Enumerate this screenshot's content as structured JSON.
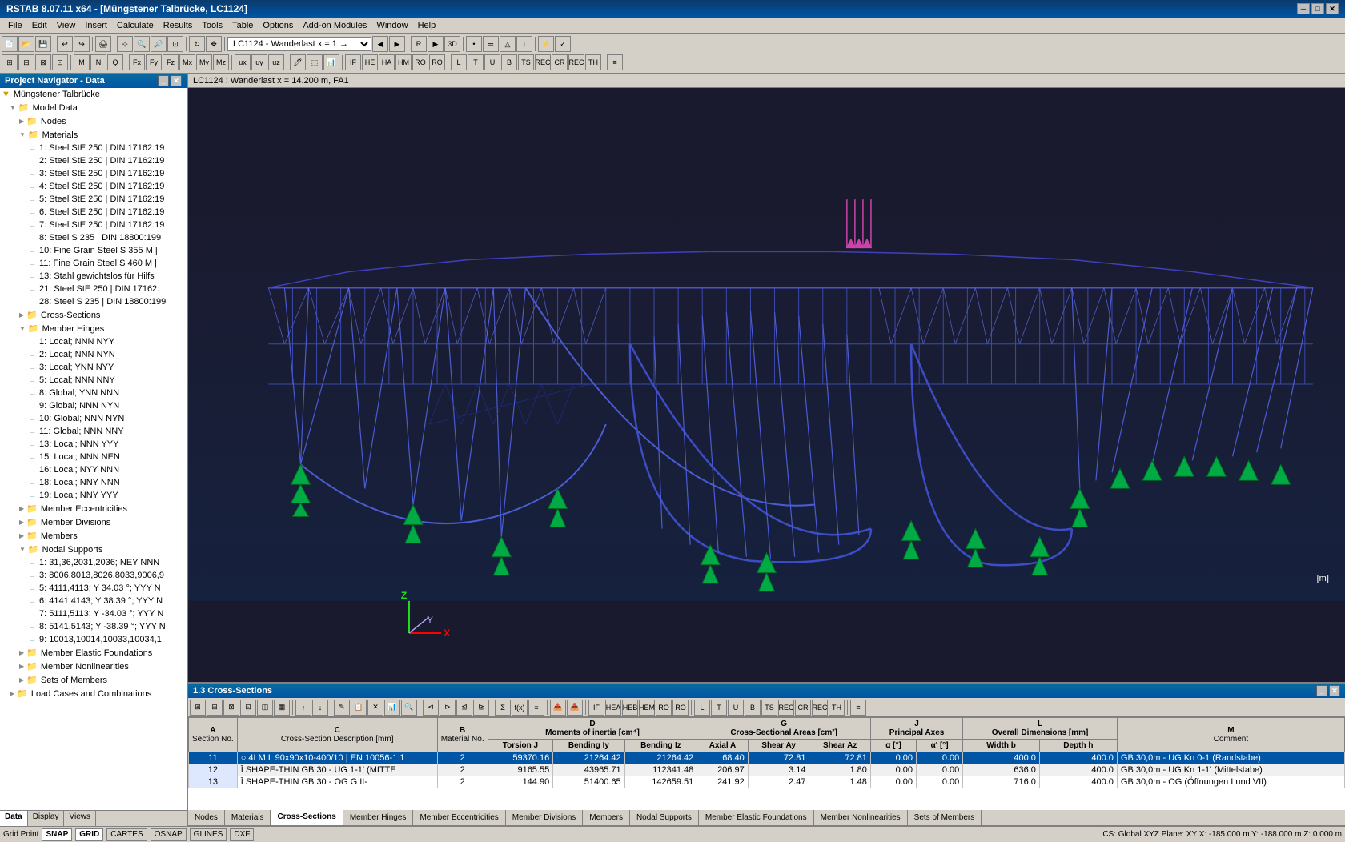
{
  "titleBar": {
    "title": "RSTAB 8.07.11 x64 - [Müngstener Talbrücke, LC1124]",
    "controls": [
      "─",
      "□",
      "✕"
    ]
  },
  "menuBar": {
    "items": [
      "File",
      "Edit",
      "View",
      "Insert",
      "Calculate",
      "Results",
      "Tools",
      "Table",
      "Options",
      "Add-on Modules",
      "Window",
      "Help"
    ]
  },
  "toolbar": {
    "lcSelector": "LC1124 - Wanderlast x = 1 →"
  },
  "viewportHeader": {
    "text": "LC1124 : Wanderlast x = 14.200 m, FA1"
  },
  "navigator": {
    "title": "Project Navigator - Data",
    "tabs": [
      "Data",
      "Display",
      "Views"
    ],
    "tree": [
      {
        "id": "root",
        "label": "Müngstener Talbrücke",
        "level": 0,
        "type": "root",
        "expanded": true
      },
      {
        "id": "model-data",
        "label": "Model Data",
        "level": 1,
        "type": "folder",
        "expanded": true
      },
      {
        "id": "nodes",
        "label": "Nodes",
        "level": 2,
        "type": "folder",
        "expanded": false
      },
      {
        "id": "materials",
        "label": "Materials",
        "level": 2,
        "type": "folder",
        "expanded": true
      },
      {
        "id": "mat1",
        "label": "1: Steel StE 250 | DIN 17162:19",
        "level": 3,
        "type": "item"
      },
      {
        "id": "mat2",
        "label": "2: Steel StE 250 | DIN 17162:19",
        "level": 3,
        "type": "item"
      },
      {
        "id": "mat3",
        "label": "3: Steel StE 250 | DIN 17162:19",
        "level": 3,
        "type": "item"
      },
      {
        "id": "mat4",
        "label": "4: Steel StE 250 | DIN 17162:19",
        "level": 3,
        "type": "item"
      },
      {
        "id": "mat5",
        "label": "5: Steel StE 250 | DIN 17162:19",
        "level": 3,
        "type": "item"
      },
      {
        "id": "mat6",
        "label": "6: Steel StE 250 | DIN 17162:19",
        "level": 3,
        "type": "item"
      },
      {
        "id": "mat7",
        "label": "7: Steel StE 250 | DIN 17162:19",
        "level": 3,
        "type": "item"
      },
      {
        "id": "mat8",
        "label": "8: Steel S 235 | DIN 18800:199",
        "level": 3,
        "type": "item"
      },
      {
        "id": "mat10",
        "label": "10: Fine Grain Steel S 355 M |",
        "level": 3,
        "type": "item"
      },
      {
        "id": "mat11",
        "label": "11: Fine Grain Steel S 460 M |",
        "level": 3,
        "type": "item"
      },
      {
        "id": "mat13",
        "label": "13: Stahl gewichtslos für Hilfs",
        "level": 3,
        "type": "item"
      },
      {
        "id": "mat21",
        "label": "21: Steel StE 250 | DIN 17162:",
        "level": 3,
        "type": "item"
      },
      {
        "id": "mat28",
        "label": "28: Steel S 235 | DIN 18800:199",
        "level": 3,
        "type": "item"
      },
      {
        "id": "cross-sections",
        "label": "Cross-Sections",
        "level": 2,
        "type": "folder",
        "expanded": false
      },
      {
        "id": "member-hinges",
        "label": "Member Hinges",
        "level": 2,
        "type": "folder",
        "expanded": true
      },
      {
        "id": "mh1",
        "label": "1: Local; NNN NYY",
        "level": 3,
        "type": "item"
      },
      {
        "id": "mh2",
        "label": "2: Local; NNN NYN",
        "level": 3,
        "type": "item"
      },
      {
        "id": "mh3",
        "label": "3: Local; YNN NYY",
        "level": 3,
        "type": "item"
      },
      {
        "id": "mh5",
        "label": "5: Local; NNN NNY",
        "level": 3,
        "type": "item"
      },
      {
        "id": "mh8",
        "label": "8: Global; YNN NNN",
        "level": 3,
        "type": "item"
      },
      {
        "id": "mh9",
        "label": "9: Global; NNN NYN",
        "level": 3,
        "type": "item"
      },
      {
        "id": "mh10",
        "label": "10: Global; NNN NYN",
        "level": 3,
        "type": "item"
      },
      {
        "id": "mh11",
        "label": "11: Global; NNN NNY",
        "level": 3,
        "type": "item"
      },
      {
        "id": "mh13",
        "label": "13: Local; NNN YYY",
        "level": 3,
        "type": "item"
      },
      {
        "id": "mh15",
        "label": "15: Local; NNN NEN",
        "level": 3,
        "type": "item"
      },
      {
        "id": "mh16",
        "label": "16: Local; NYY NNN",
        "level": 3,
        "type": "item"
      },
      {
        "id": "mh18",
        "label": "18: Local; NNY NNN",
        "level": 3,
        "type": "item"
      },
      {
        "id": "mh19",
        "label": "19: Local; NNY YYY",
        "level": 3,
        "type": "item"
      },
      {
        "id": "member-eccentricities",
        "label": "Member Eccentricities",
        "level": 2,
        "type": "folder",
        "expanded": false
      },
      {
        "id": "member-divisions",
        "label": "Member Divisions",
        "level": 2,
        "type": "folder",
        "expanded": false
      },
      {
        "id": "members",
        "label": "Members",
        "level": 2,
        "type": "folder",
        "expanded": false
      },
      {
        "id": "nodal-supports",
        "label": "Nodal Supports",
        "level": 2,
        "type": "folder",
        "expanded": true
      },
      {
        "id": "ns1",
        "label": "1: 31,36,2031,2036; NEY NNN",
        "level": 3,
        "type": "item"
      },
      {
        "id": "ns3",
        "label": "3: 8006,8013,8026,8033,9006,9",
        "level": 3,
        "type": "item"
      },
      {
        "id": "ns5",
        "label": "5: 4111,4113; Y 34.03 °; YYY N",
        "level": 3,
        "type": "item"
      },
      {
        "id": "ns6",
        "label": "6: 4141,4143; Y 38.39 °; YYY N",
        "level": 3,
        "type": "item"
      },
      {
        "id": "ns7",
        "label": "7: 5111,5113; Y -34.03 °; YYY N",
        "level": 3,
        "type": "item"
      },
      {
        "id": "ns8",
        "label": "8: 5141,5143; Y -38.39 °; YYY N",
        "level": 3,
        "type": "item"
      },
      {
        "id": "ns9",
        "label": "9: 10013,10014,10033,10034,1",
        "level": 3,
        "type": "item"
      },
      {
        "id": "member-elastic-foundations",
        "label": "Member Elastic Foundations",
        "level": 2,
        "type": "folder",
        "expanded": false
      },
      {
        "id": "member-nonlinearities",
        "label": "Member Nonlinearities",
        "level": 2,
        "type": "folder",
        "expanded": false
      },
      {
        "id": "sets-of-members",
        "label": "Sets of Members",
        "level": 2,
        "type": "folder",
        "expanded": false
      },
      {
        "id": "load-cases",
        "label": "Load Cases and Combinations",
        "level": 1,
        "type": "folder",
        "expanded": false
      }
    ]
  },
  "bottomPanel": {
    "title": "1.3 Cross-Sections",
    "tabs": [
      "Nodes",
      "Materials",
      "Cross-Sections",
      "Member Hinges",
      "Member Eccentricities",
      "Member Divisions",
      "Members",
      "Nodal Supports",
      "Member Elastic Foundations",
      "Member Nonlinearities",
      "Sets of Members"
    ],
    "activeTab": "Cross-Sections",
    "tableHeaders": {
      "A": "Section No.",
      "B": "Material No.",
      "C": "Cross-Section Description [mm]",
      "D_main": "Moments of inertia [cm⁴]",
      "D_sub1": "Torsion J",
      "E_sub": "Bending Iy",
      "F_sub": "Bending Iz",
      "G_main": "Cross-Sectional Areas [cm²]",
      "G_sub": "Axial A",
      "H_sub": "Shear Ay",
      "I_sub": "Shear Az",
      "J_main": "Principal Axes",
      "J_sub": "α [°]",
      "K_sub": "α' [°]",
      "L_main": "Overall Dimensions [mm]",
      "L_sub": "Width b",
      "M_sub": "Depth h",
      "N": "Comment"
    },
    "rows": [
      {
        "no": "11",
        "material": "2",
        "description": "○ 4LM L 90x90x10-400/10 | EN 10056-1:1",
        "torsionJ": "59370.16",
        "bendingIy": "21264.42",
        "bendingIz": "21264.42",
        "axialA": "68.40",
        "shearAy": "72.81",
        "shearAz": "72.81",
        "alphaPA": "0.00",
        "alphaPrime": "0.00",
        "widthB": "400.0",
        "depthH": "400.0",
        "comment": "GB 30,0m - UG Kn 0-1 (Randstabe)",
        "selected": true
      },
      {
        "no": "12",
        "material": "2",
        "description": "Ī SHAPE-THIN GB 30 - UG 1-1' (MITTE",
        "torsionJ": "9165.55",
        "bendingIy": "43965.71",
        "bendingIz": "112341.48",
        "axialA": "206.97",
        "shearAy": "3.14",
        "shearAz": "1.80",
        "alphaPA": "0.00",
        "alphaPrime": "0.00",
        "widthB": "636.0",
        "depthH": "400.0",
        "comment": "GB 30,0m - UG Kn 1-1' (Mittelstabe)",
        "selected": false
      },
      {
        "no": "13",
        "material": "2",
        "description": "Ī SHAPE-THIN GB 30 - OG G II-",
        "torsionJ": "144.90",
        "bendingIy": "51400.65",
        "bendingIz": "142659.51",
        "axialA": "241.92",
        "shearAy": "2.47",
        "shearAz": "1.48",
        "alphaPA": "0.00",
        "alphaPrime": "0.00",
        "widthB": "716.0",
        "depthH": "400.0",
        "comment": "GB 30,0m - OG (Öffnungen I und VII)",
        "selected": false
      }
    ]
  },
  "statusBar": {
    "gridPoint": "Grid Point",
    "items": [
      "SNAP",
      "GRID",
      "CARTES",
      "OSNAP",
      "GLINES",
      "DXF"
    ],
    "activeItems": [
      "SNAP",
      "GRID"
    ],
    "coords": "CS: Global XYZ   Plane: XY     X: -185.000 m  Y: -188.000 m  Z: 0.000 m"
  }
}
